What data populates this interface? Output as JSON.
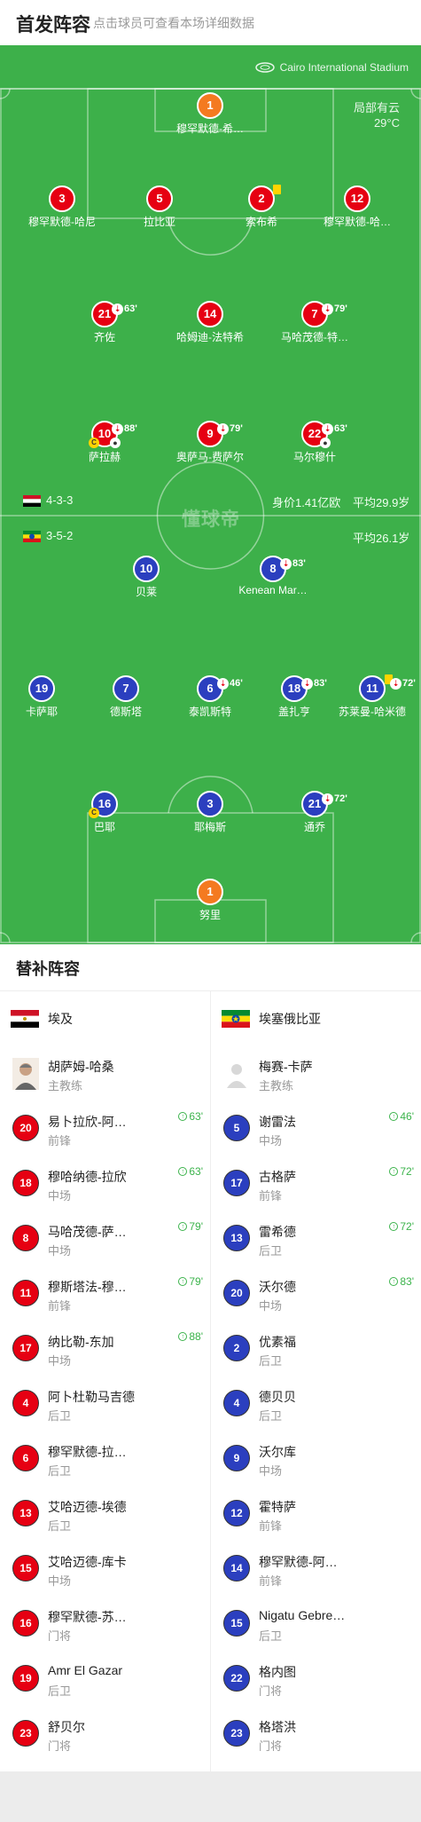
{
  "header": {
    "title": "首发阵容",
    "subtitle": "点击球员可查看本场详细数据"
  },
  "pitch": {
    "stadium": "Cairo International Stadium",
    "weather": "局部有云",
    "temperature": "29°C",
    "watermark": "懂球帝",
    "home_formation": "4-3-3",
    "away_formation": "3-5-2",
    "home_value": "身价1.41亿欧",
    "home_avg_age": "平均29.9岁",
    "away_avg_age": "平均26.1岁"
  },
  "home_players": [
    {
      "num": "1",
      "name": "穆罕默德-希…",
      "sub": ""
    },
    {
      "num": "3",
      "name": "穆罕默德-哈尼",
      "sub": ""
    },
    {
      "num": "5",
      "name": "拉比亚",
      "sub": ""
    },
    {
      "num": "2",
      "name": "索布希",
      "sub": ""
    },
    {
      "num": "12",
      "name": "穆罕默德-哈…",
      "sub": ""
    },
    {
      "num": "21",
      "name": "齐佐",
      "sub": "63'"
    },
    {
      "num": "14",
      "name": "哈姆迪-法特希",
      "sub": ""
    },
    {
      "num": "7",
      "name": "马哈茂德-特…",
      "sub": "79'"
    },
    {
      "num": "10",
      "name": "萨拉赫",
      "sub": "88'"
    },
    {
      "num": "9",
      "name": "奥萨马-费萨尔",
      "sub": "79'"
    },
    {
      "num": "22",
      "name": "马尔穆什",
      "sub": "63'"
    }
  ],
  "away_players": [
    {
      "num": "10",
      "name": "贝莱",
      "sub": ""
    },
    {
      "num": "8",
      "name": "Kenean Mar…",
      "sub": "83'"
    },
    {
      "num": "19",
      "name": "卡萨耶",
      "sub": ""
    },
    {
      "num": "7",
      "name": "德斯塔",
      "sub": ""
    },
    {
      "num": "6",
      "name": "泰凯斯特",
      "sub": "46'"
    },
    {
      "num": "18",
      "name": "盖扎亨",
      "sub": "83'"
    },
    {
      "num": "11",
      "name": "苏莱曼-哈米德",
      "sub": "72'"
    },
    {
      "num": "16",
      "name": "巴耶",
      "sub": ""
    },
    {
      "num": "3",
      "name": "耶梅斯",
      "sub": ""
    },
    {
      "num": "21",
      "name": "通乔",
      "sub": "72'"
    },
    {
      "num": "1",
      "name": "努里",
      "sub": ""
    }
  ],
  "subs": {
    "title": "替补阵容",
    "home": {
      "team": "埃及",
      "coach_name": "胡萨姆-哈桑",
      "coach_role": "主教练",
      "players": [
        {
          "num": "20",
          "name": "易卜拉欣-阿…",
          "pos": "前锋",
          "time": "63'"
        },
        {
          "num": "18",
          "name": "穆哈纳德-拉欣",
          "pos": "中场",
          "time": "63'"
        },
        {
          "num": "8",
          "name": "马哈茂德-萨…",
          "pos": "中场",
          "time": "79'"
        },
        {
          "num": "11",
          "name": "穆斯塔法-穆…",
          "pos": "前锋",
          "time": "79'"
        },
        {
          "num": "17",
          "name": "纳比勒-东加",
          "pos": "中场",
          "time": "88'"
        },
        {
          "num": "4",
          "name": "阿卜杜勒马吉德",
          "pos": "后卫",
          "time": ""
        },
        {
          "num": "6",
          "name": "穆罕默德-拉…",
          "pos": "后卫",
          "time": ""
        },
        {
          "num": "13",
          "name": "艾哈迈德-埃德",
          "pos": "后卫",
          "time": ""
        },
        {
          "num": "15",
          "name": "艾哈迈德-库卡",
          "pos": "中场",
          "time": ""
        },
        {
          "num": "16",
          "name": "穆罕默德-苏…",
          "pos": "门将",
          "time": ""
        },
        {
          "num": "19",
          "name": "Amr El Gazar",
          "pos": "后卫",
          "time": ""
        },
        {
          "num": "23",
          "name": "舒贝尔",
          "pos": "门将",
          "time": ""
        }
      ]
    },
    "away": {
      "team": "埃塞俄比亚",
      "coach_name": "梅赛-卡萨",
      "coach_role": "主教练",
      "players": [
        {
          "num": "5",
          "name": "谢雷法",
          "pos": "中场",
          "time": "46'"
        },
        {
          "num": "17",
          "name": "古格萨",
          "pos": "前锋",
          "time": "72'"
        },
        {
          "num": "13",
          "name": "雷希德",
          "pos": "后卫",
          "time": "72'"
        },
        {
          "num": "20",
          "name": "沃尔德",
          "pos": "中场",
          "time": "83'"
        },
        {
          "num": "2",
          "name": "优素福",
          "pos": "后卫",
          "time": ""
        },
        {
          "num": "4",
          "name": "德贝贝",
          "pos": "后卫",
          "time": ""
        },
        {
          "num": "9",
          "name": "沃尔库",
          "pos": "中场",
          "time": ""
        },
        {
          "num": "12",
          "name": "霍特萨",
          "pos": "前锋",
          "time": ""
        },
        {
          "num": "14",
          "name": "穆罕默德-阿…",
          "pos": "前锋",
          "time": ""
        },
        {
          "num": "15",
          "name": "Nigatu Gebre…",
          "pos": "后卫",
          "time": ""
        },
        {
          "num": "22",
          "name": "格内图",
          "pos": "门将",
          "time": ""
        },
        {
          "num": "23",
          "name": "格塔洪",
          "pos": "门将",
          "time": ""
        }
      ]
    }
  },
  "colors": {
    "pitch": "#3db04a",
    "home": "#e60012",
    "away": "#2b3fbf",
    "gk": "#f47a20"
  }
}
